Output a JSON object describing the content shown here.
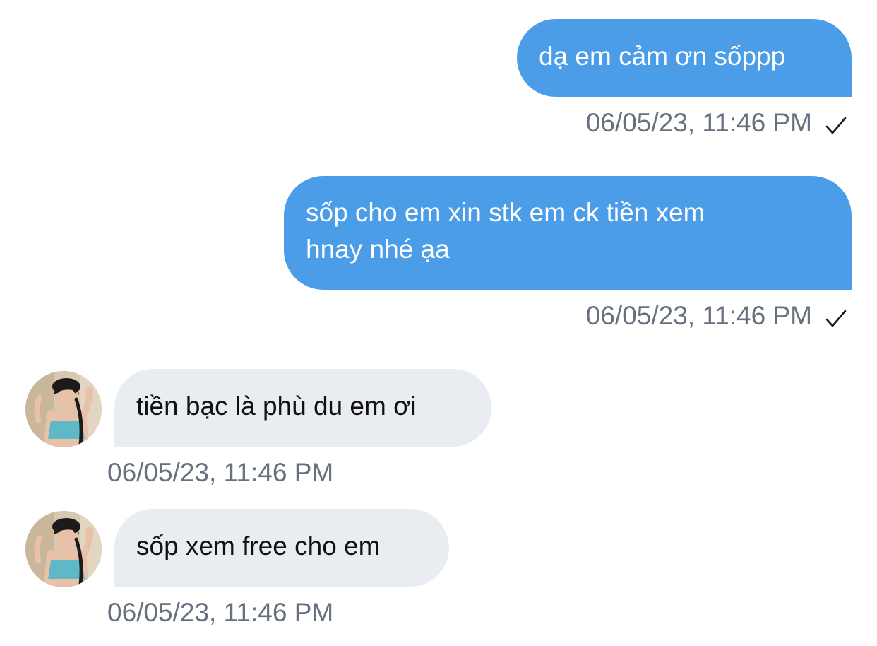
{
  "colors": {
    "outgoing_bubble": "#4c9de8",
    "incoming_bubble": "#e9ecf0",
    "timestamp": "#66707e",
    "background": "#ffffff"
  },
  "messages": [
    {
      "direction": "outgoing",
      "text": "dạ em cảm ơn sốppp",
      "timestamp": "06/05/23, 11:46 PM",
      "status_icon": "checkmark-icon"
    },
    {
      "direction": "outgoing",
      "lines": [
        "sốp cho em xin stk em ck tiền xem",
        "hnay nhé ạa"
      ],
      "timestamp": "06/05/23, 11:46 PM",
      "status_icon": "checkmark-icon"
    },
    {
      "direction": "incoming",
      "text": "tiền bạc là phù du em ơi",
      "timestamp": "06/05/23, 11:46 PM",
      "avatar_icon": "avatar"
    },
    {
      "direction": "incoming",
      "text": "sốp xem free cho em",
      "timestamp": "06/05/23, 11:46 PM",
      "avatar_icon": "avatar"
    }
  ]
}
